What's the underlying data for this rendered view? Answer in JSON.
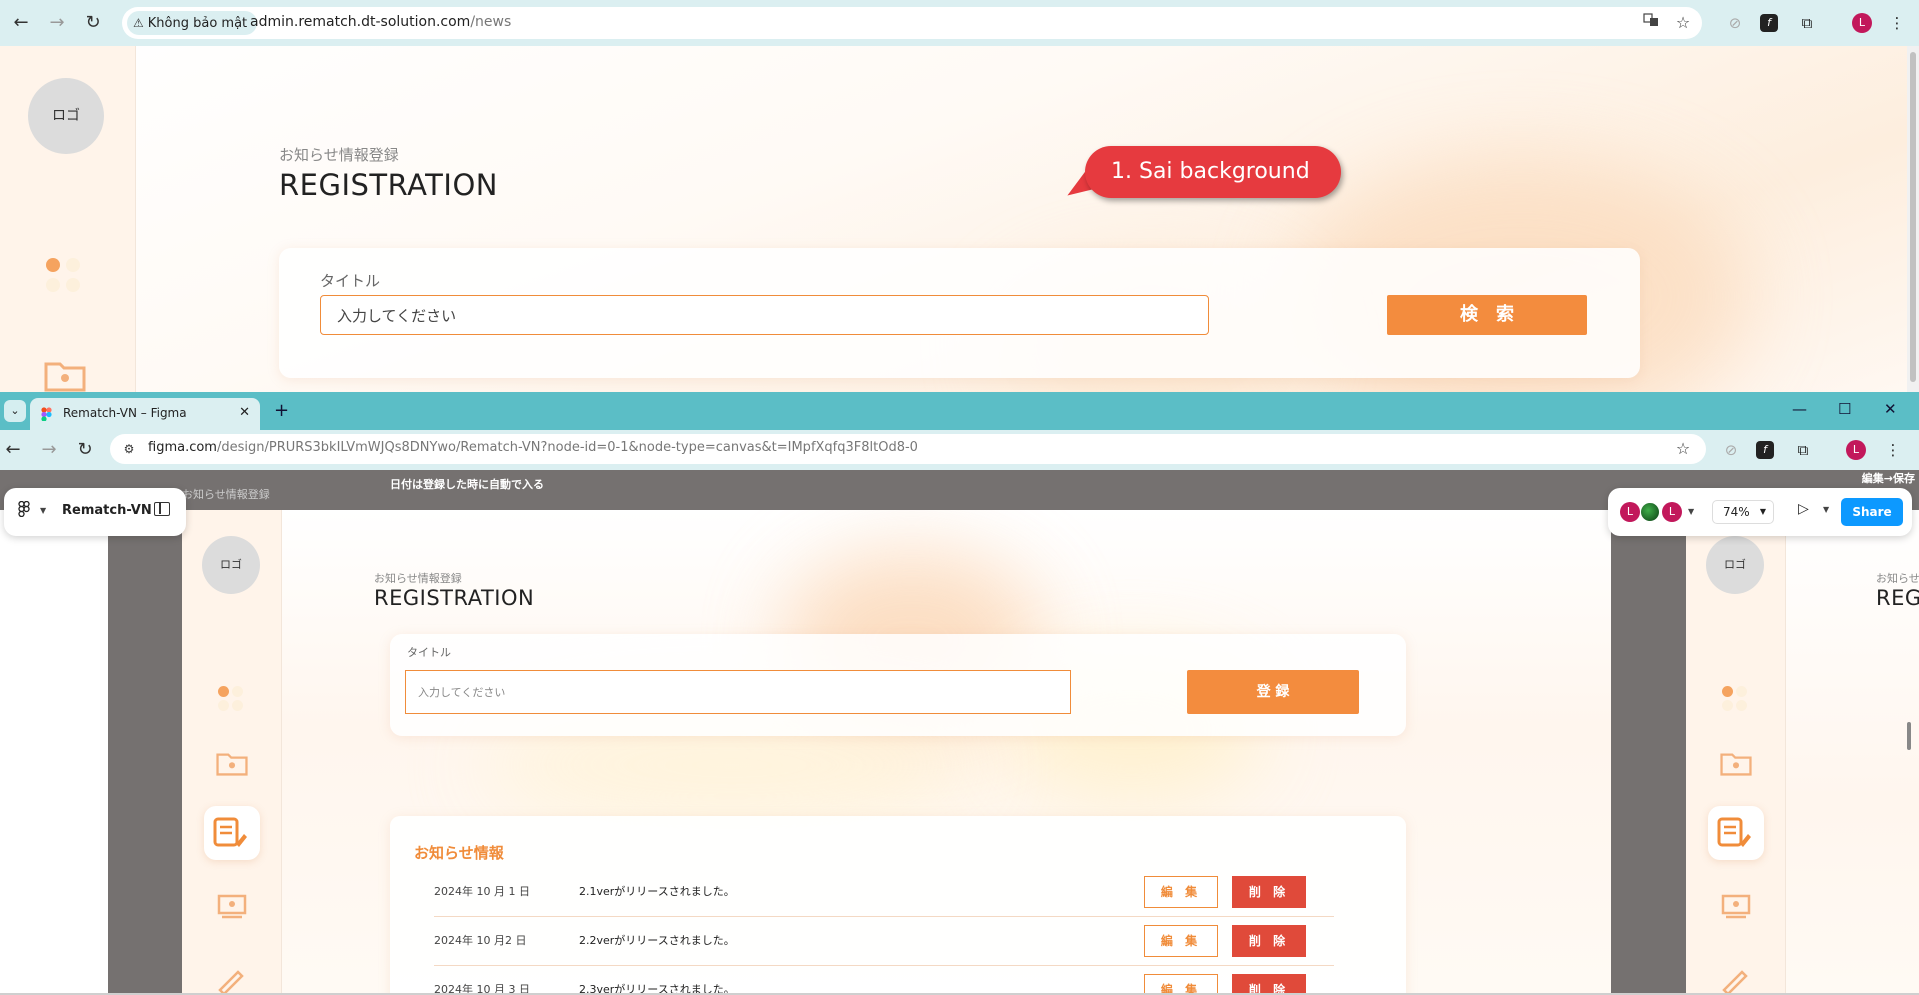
{
  "top_window": {
    "security_chip": "Không bảo mật",
    "url_host": "admin.rematch.dt-solution.com",
    "url_path": "/news",
    "avatar": "L",
    "page": {
      "logo": "ロゴ",
      "subtitle": "お知らせ情報登録",
      "title": "REGISTRATION",
      "field_label": "タイトル",
      "field_placeholder": "入力してください",
      "search_button": "検　索"
    },
    "annotation": "1. Sai background"
  },
  "bottom_window": {
    "tab_title": "Rematch-VN – Figma",
    "url_host": "figma.com",
    "url_path": "/design/PRURS3bkILVmWJQs8DNYwo/Rematch-VN?node-id=0-1&node-type=canvas&t=IMpfXqfq3F8ltOd8-0",
    "avatar": "L",
    "figma": {
      "file_name": "Rematch-VN",
      "frame_label": "お知らせ情報登録",
      "note": "日付は登録した時に自動で入る",
      "edit_save": "編集→保存",
      "zoom": "74%",
      "share": "Share",
      "collaborators": [
        "L",
        "L"
      ]
    },
    "design": {
      "logo": "ロゴ",
      "subtitle": "お知らせ情報登録",
      "title": "REGISTRATION",
      "field_label": "タイトル",
      "field_placeholder": "入力してください",
      "register_button": "登 録",
      "news_heading": "お知らせ情報",
      "edit_label": "編 集",
      "delete_label": "削 除",
      "news": [
        {
          "date": "2024年 10 月 1 日",
          "text": "2.1verがリリースされました。"
        },
        {
          "date": "2024年 10 月2 日",
          "text": "2.2verがリリースされました。"
        },
        {
          "date": "2024年 10 月 3 日",
          "text": "2.3verがリリースされました。"
        }
      ]
    },
    "second_frame": {
      "logo": "ロゴ",
      "subtitle": "お知らせ",
      "title": "REG"
    }
  },
  "colors": {
    "accent_orange": "#f38c3e",
    "delete_red": "#e04a3a",
    "callout_red": "#e63a3f",
    "tab_strip": "#5bbec6",
    "figma_blue": "#0d99ff"
  }
}
